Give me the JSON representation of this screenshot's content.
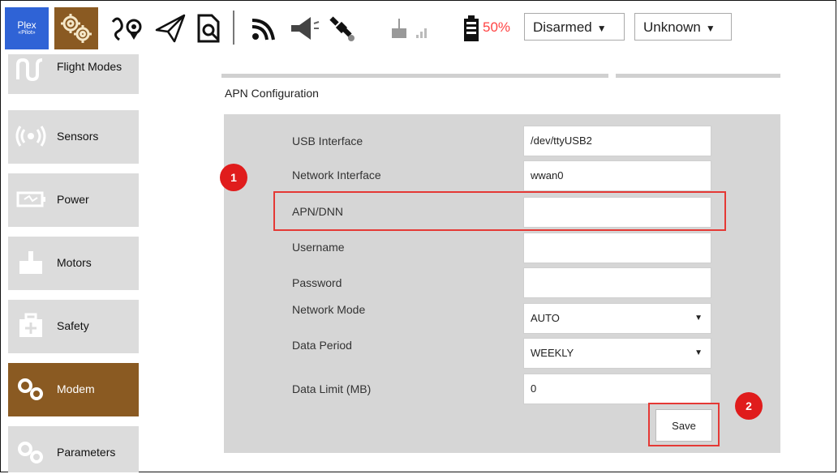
{
  "toolbar": {
    "logo_line1": "Plex",
    "logo_line2": "«Pilot»",
    "battery_percent": "50%",
    "arm_state": "Disarmed",
    "flight_mode": "Unknown",
    "icons": [
      "gear-icon",
      "route-waypoint-icon",
      "paper-plane-icon",
      "document-search-icon",
      "telemetry-signal-icon",
      "megaphone-icon",
      "satellite-icon",
      "rc-signal-icon",
      "battery-icon"
    ]
  },
  "sidebar": {
    "items": [
      {
        "label": "Flight Modes",
        "icon": "flight-modes-icon"
      },
      {
        "label": "Sensors",
        "icon": "sensors-icon"
      },
      {
        "label": "Power",
        "icon": "power-icon"
      },
      {
        "label": "Motors",
        "icon": "motors-icon"
      },
      {
        "label": "Safety",
        "icon": "safety-icon"
      },
      {
        "label": "Modem",
        "icon": "modem-icon",
        "active": true
      },
      {
        "label": "Parameters",
        "icon": "parameters-icon"
      }
    ]
  },
  "main": {
    "section_title": "APN Configuration",
    "fields": [
      {
        "label": "USB Interface",
        "value": "/dev/ttyUSB2"
      },
      {
        "label": "Network Interface",
        "value": "wwan0"
      },
      {
        "label": "APN/DNN",
        "value": ""
      },
      {
        "label": "Username",
        "value": ""
      },
      {
        "label": "Password",
        "value": ""
      },
      {
        "label": "Network Mode",
        "value": "AUTO"
      },
      {
        "label": "Data Period",
        "value": "WEEKLY"
      },
      {
        "label": "Data Limit (MB)",
        "value": "0"
      }
    ],
    "save_label": "Save",
    "callout_1": "1",
    "callout_2": "2",
    "highlight_color": "#e53935"
  }
}
